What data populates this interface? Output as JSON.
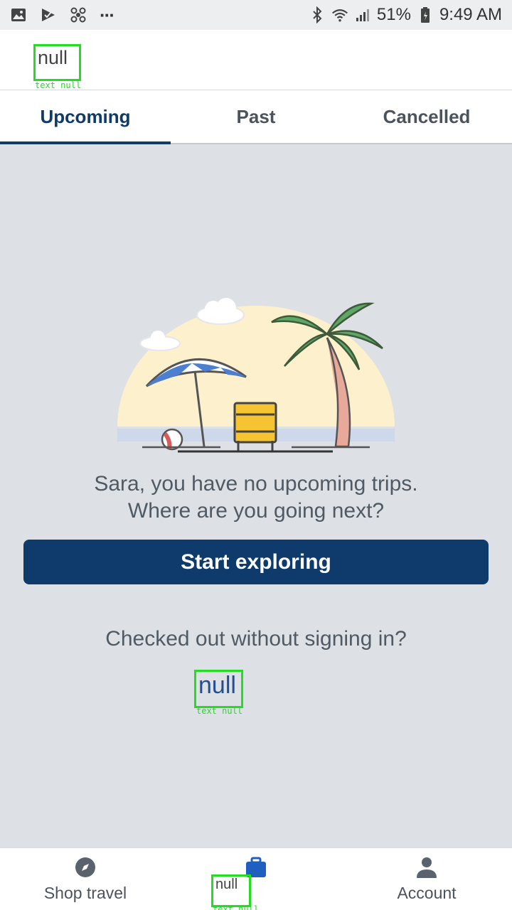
{
  "status_bar": {
    "battery": "51%",
    "time": "9:49 AM",
    "more": "···",
    "icons_left": [
      "image-icon",
      "check-send-icon",
      "fan-icon",
      "more-icon"
    ],
    "icons_right": [
      "bluetooth-icon",
      "wifi-icon",
      "signal-icon",
      "battery-icon"
    ]
  },
  "app_bar": {
    "title": "null",
    "title_tag": "text null"
  },
  "tabs": [
    {
      "label": "Upcoming",
      "active": true
    },
    {
      "label": "Past",
      "active": false
    },
    {
      "label": "Cancelled",
      "active": false
    }
  ],
  "empty_state": {
    "message_line1": "Sara, you have no upcoming trips.",
    "message_line2": "Where are you going next?",
    "cta_label": "Start exploring",
    "signed_out_prompt": "Checked out without signing in?",
    "link_text": "null",
    "link_tag": "text null"
  },
  "bottom_nav": {
    "shop_label": "Shop travel",
    "trips_label": "null",
    "trips_tag": "text null",
    "account_label": "Account"
  },
  "colors": {
    "accent": "#0e3a6c",
    "annotation": "#22dd22",
    "background": "#dde1e5"
  }
}
